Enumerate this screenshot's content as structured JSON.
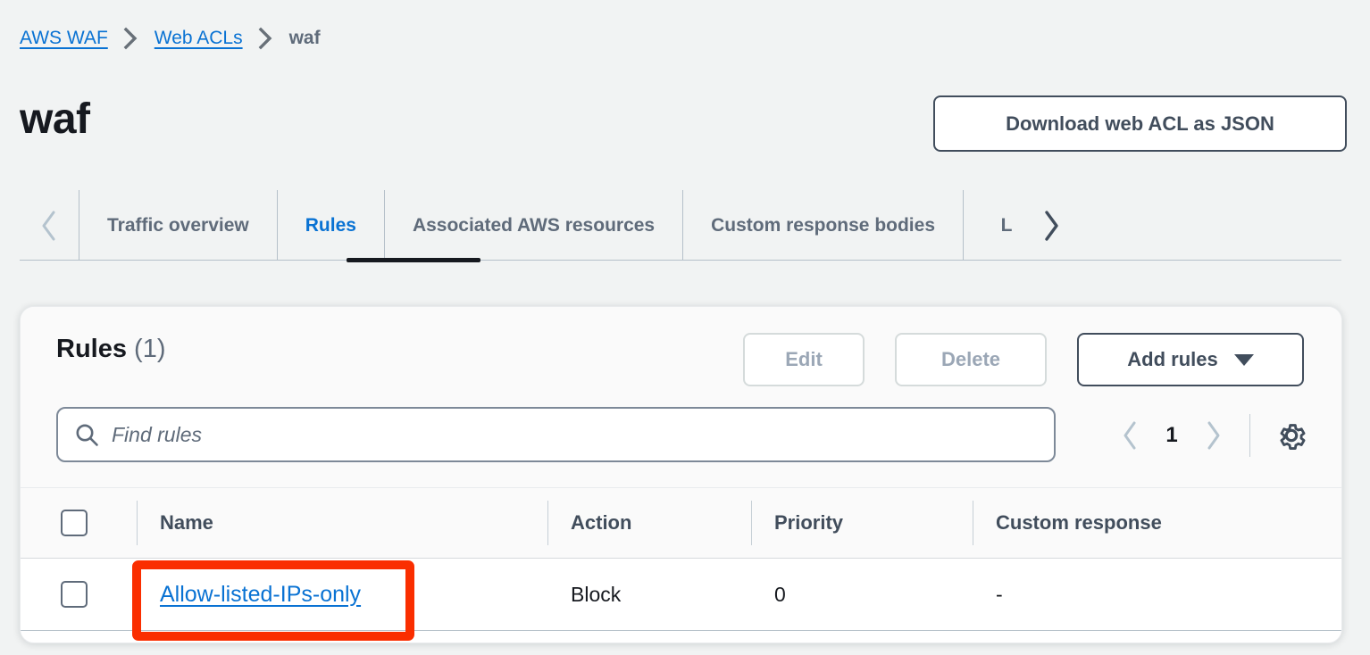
{
  "breadcrumb": {
    "items": [
      {
        "label": "AWS WAF",
        "type": "link"
      },
      {
        "label": "Web ACLs",
        "type": "link"
      },
      {
        "label": "waf",
        "type": "current"
      }
    ]
  },
  "header": {
    "title": "waf",
    "download_button": "Download web ACL as JSON"
  },
  "tabs": {
    "scroll_left_icon": "chevron-left-icon",
    "scroll_right_icon": "chevron-right-icon",
    "items": [
      {
        "label": "Traffic overview",
        "active": false
      },
      {
        "label": "Rules",
        "active": true
      },
      {
        "label": "Associated AWS resources",
        "active": false
      },
      {
        "label": "Custom response bodies",
        "active": false
      },
      {
        "label": "L",
        "active": false
      }
    ]
  },
  "rules_panel": {
    "title": "Rules",
    "count": "(1)",
    "buttons": {
      "edit": "Edit",
      "delete": "Delete",
      "add_rules": "Add rules"
    },
    "search": {
      "placeholder": "Find rules",
      "value": "",
      "icon": "search-icon"
    },
    "pagination": {
      "prev_icon": "chevron-left-icon",
      "next_icon": "chevron-right-icon",
      "current_page": "1",
      "settings_icon": "gear-icon"
    },
    "table": {
      "columns": [
        "Name",
        "Action",
        "Priority",
        "Custom response"
      ],
      "rows": [
        {
          "name": "Allow-listed-IPs-only",
          "action": "Block",
          "priority": "0",
          "custom_response": "-"
        }
      ]
    }
  },
  "annotation": {
    "target": "Allow-listed-IPs-only",
    "color": "#fa2e00"
  },
  "colors": {
    "page_background": "#f1f3f3",
    "link_blue": "#0972d3",
    "text_dark": "#16191f",
    "text_secondary": "#5f6b7a",
    "border": "#b5c0c9",
    "annotation_red": "#fa2e00"
  }
}
